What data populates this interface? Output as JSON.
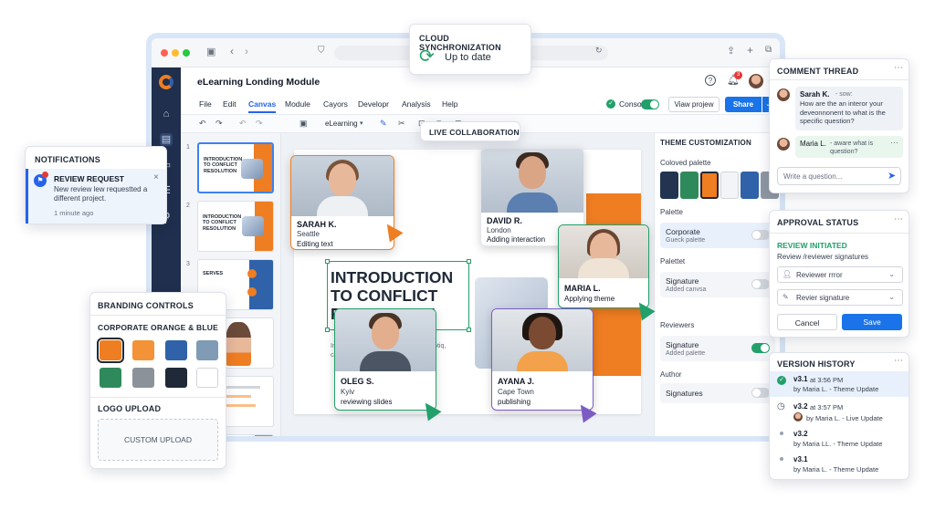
{
  "app": {
    "title": "eLearning Londing Module",
    "menu": [
      "File",
      "Edit",
      "Canvas",
      "Module",
      "Cayors",
      "Developr",
      "Analysis",
      "Help"
    ],
    "active_menu": "Canvas",
    "demo_label": "Conso",
    "view_label": "Viaw projew",
    "share_label": "Share",
    "toolbar_dropdown": "eLearning",
    "notification_count": "3"
  },
  "sync": {
    "title": "CLOUD SYNCHRONIZATION",
    "status": "Up to date"
  },
  "live": {
    "title": "LIVE COLLABORATION"
  },
  "slides": [
    {
      "num": "1",
      "title": "INTRODUCTION TO CONFLICT RESOLUTION"
    },
    {
      "num": "2",
      "title": "INTRODUCTION TO CONFLICT RESOLUTION"
    },
    {
      "num": "3",
      "title": "SERVES"
    }
  ],
  "slide": {
    "title": "INTRODUCTION TO CONFLICT RESOLUTION",
    "body_a": "Int",
    "body_b": "siotiq,",
    "body_c": "cas"
  },
  "collaborators": [
    {
      "name": "SARAH K.",
      "city": "Seattle",
      "action": "Editing text"
    },
    {
      "name": "DAVID R.",
      "city": "London",
      "action": "Adding interaction"
    },
    {
      "name": "MARIA L.",
      "city": "",
      "action": "Applying theme"
    },
    {
      "name": "OLEG S.",
      "city": "Kyiv",
      "action": "reviewing slides"
    },
    {
      "name": "AYANA J.",
      "city": "Cape Town",
      "action": "publishing"
    }
  ],
  "notifications": {
    "title": "NOTIFICATIONS",
    "item_title": "REVIEW REQUEST",
    "item_body": "New review lew requestted a different project.",
    "item_time": "1 minute ago"
  },
  "branding": {
    "title": "BRANDING CONTROLS",
    "palette_name": "CORPORATE ORANGE & BLUE",
    "swatches": [
      "#ef7d22",
      "#f39237",
      "#2f62a8",
      "#7f9bb5",
      "#2f8a5b",
      "#8c9299",
      "#1f2937",
      "#ffffff"
    ],
    "logo_title": "LOGO UPLOAD",
    "upload_label": "CUSTOM UPLOAD"
  },
  "theme": {
    "title": "THEME CUSTOMIZATION",
    "palette_label": "Coloved palette",
    "palette_colors": [
      "#22344f",
      "#2f8a5b",
      "#ef7d22",
      "#f2f4f7",
      "#2f62a8",
      "#8f98a3"
    ],
    "section_palette": "Palette",
    "corporate": "Corporate",
    "corporate_sub": "Gueck palette",
    "section_palettet": "Palettet",
    "signature": "Signature",
    "signature_sub": "Added canvsa",
    "section_reviewers": "Reviewers",
    "rev_signature": "Signature",
    "rev_signature_sub": "Added palette",
    "section_author": "Author",
    "signatures": "Signatures"
  },
  "comments": {
    "title": "COMMENT THREAD",
    "c1_author": "Sarah K.",
    "c1_meta": "- sow:",
    "c1_text": "How are the an interor your deveonnonent to what is the specific question?",
    "c2_author": "Maria L.",
    "c2_meta": "- aware what is question?",
    "placeholder": "Write a question..."
  },
  "approval": {
    "title": "APPROVAL STATUS",
    "status": "REVIEW INITIATED",
    "subtitle": "Review /reviewer signatures",
    "reviewer": "Reviewer rrror",
    "signature": "Revier signature",
    "cancel": "Cancel",
    "save": "Save"
  },
  "versions": {
    "title": "VERSION HISTORY",
    "items": [
      {
        "ver": "v3.1",
        "time": "at 3:56 PM",
        "by": "by Maria L. - Theme Update"
      },
      {
        "ver": "v3.2",
        "time": "at 3:57 PM",
        "by": "by Maria L. - Live Update"
      },
      {
        "ver": "v3.2",
        "time": "",
        "by": "by Maria LL. - Theme Update"
      },
      {
        "ver": "v3.1",
        "time": "",
        "by": "by Maria L. - Theme Update"
      }
    ]
  }
}
